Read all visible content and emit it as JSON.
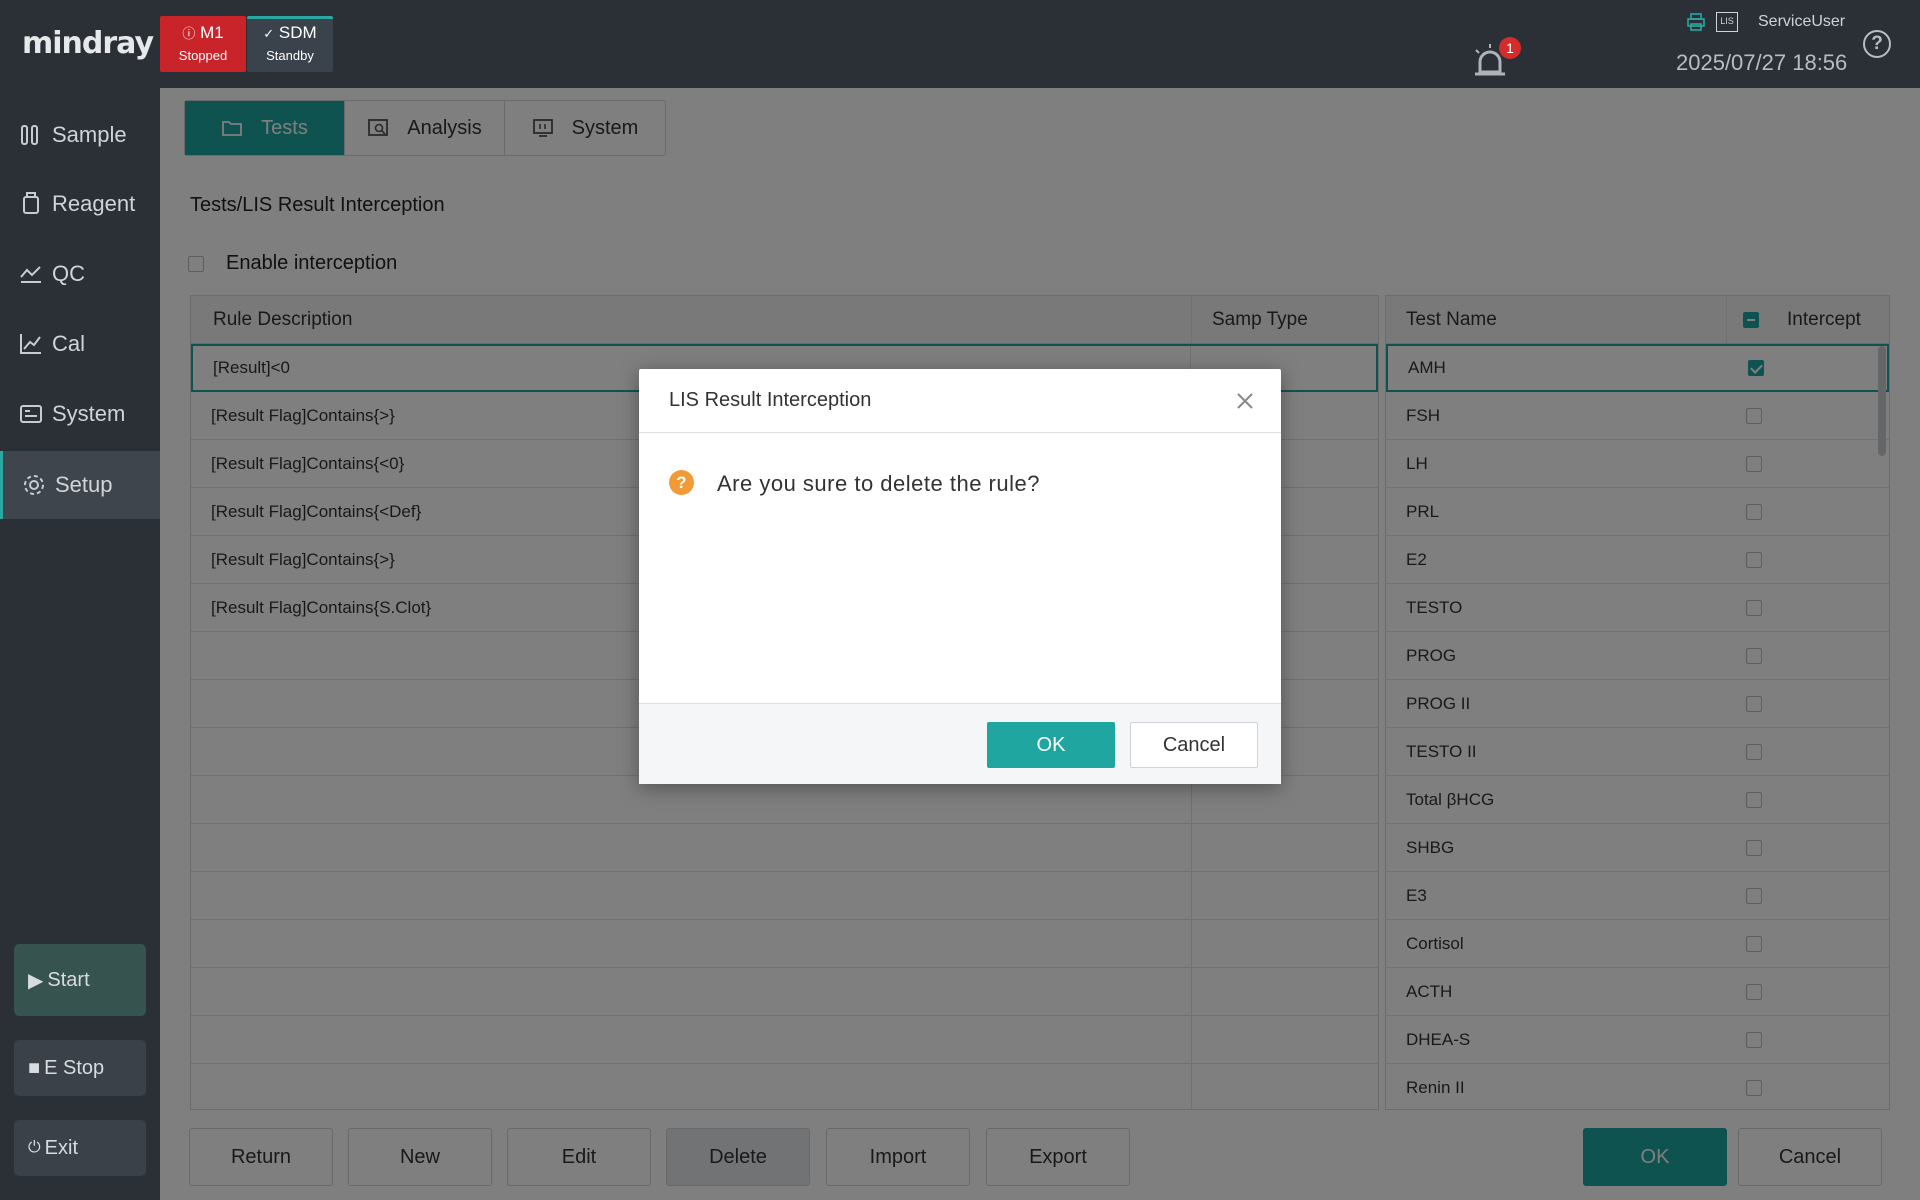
{
  "brand": "mindray",
  "modules": [
    {
      "name": "M1",
      "status": "Stopped",
      "color": "#c8242a"
    },
    {
      "name": "SDM",
      "status": "Standby",
      "color": "#3a424c"
    }
  ],
  "header": {
    "alarm_count": "1",
    "lis_label": "LIS",
    "user": "ServiceUser",
    "datetime": "2025/07/27 18:56",
    "help": "?"
  },
  "sidebar": {
    "items": [
      {
        "label": "Sample",
        "icon": "sample-icon"
      },
      {
        "label": "Reagent",
        "icon": "reagent-icon"
      },
      {
        "label": "QC",
        "icon": "qc-icon"
      },
      {
        "label": "Cal",
        "icon": "cal-icon"
      },
      {
        "label": "System",
        "icon": "system-icon"
      },
      {
        "label": "Setup",
        "icon": "gear-icon",
        "active": true
      }
    ],
    "start": "Start",
    "estop": "E Stop",
    "exit": "Exit"
  },
  "tabs": [
    {
      "label": "Tests",
      "active": true
    },
    {
      "label": "Analysis"
    },
    {
      "label": "System"
    }
  ],
  "breadcrumb": "Tests/LIS Result Interception",
  "enable_interception": {
    "label": "Enable interception",
    "checked": false
  },
  "rules_table": {
    "headers": [
      "Rule Description",
      "Samp Type"
    ],
    "rows": [
      {
        "desc": "[Result]<0",
        "samp": ""
      },
      {
        "desc": "[Result Flag]Contains{>}",
        "samp": ""
      },
      {
        "desc": "[Result Flag]Contains{<0}",
        "samp": ""
      },
      {
        "desc": "[Result Flag]Contains{<Def}",
        "samp": ""
      },
      {
        "desc": "[Result Flag]Contains{>}",
        "samp": ""
      },
      {
        "desc": "[Result Flag]Contains{S.Clot}",
        "samp": ""
      }
    ]
  },
  "tests_table": {
    "headers": [
      "Test Name",
      "Intercept"
    ],
    "rows": [
      {
        "name": "AMH",
        "intercept": true
      },
      {
        "name": "FSH",
        "intercept": false
      },
      {
        "name": "LH",
        "intercept": false
      },
      {
        "name": "PRL",
        "intercept": false
      },
      {
        "name": "E2",
        "intercept": false
      },
      {
        "name": "TESTO",
        "intercept": false
      },
      {
        "name": "PROG",
        "intercept": false
      },
      {
        "name": "PROG II",
        "intercept": false
      },
      {
        "name": "TESTO II",
        "intercept": false
      },
      {
        "name": "Total βHCG",
        "intercept": false
      },
      {
        "name": "SHBG",
        "intercept": false
      },
      {
        "name": "E3",
        "intercept": false
      },
      {
        "name": "Cortisol",
        "intercept": false
      },
      {
        "name": "ACTH",
        "intercept": false
      },
      {
        "name": "DHEA-S",
        "intercept": false
      },
      {
        "name": "Renin II",
        "intercept": false
      }
    ]
  },
  "bottom_buttons": {
    "return": "Return",
    "new": "New",
    "edit": "Edit",
    "delete": "Delete",
    "import": "Import",
    "export": "Export",
    "ok": "OK",
    "cancel": "Cancel"
  },
  "dialog": {
    "title": "LIS Result Interception",
    "message": "Are you sure to delete the rule?",
    "ok": "OK",
    "cancel": "Cancel"
  },
  "colors": {
    "accent": "#1fa6a0",
    "topbar": "#2b3036",
    "stopped": "#c8242a",
    "warning": "#f39a36"
  }
}
